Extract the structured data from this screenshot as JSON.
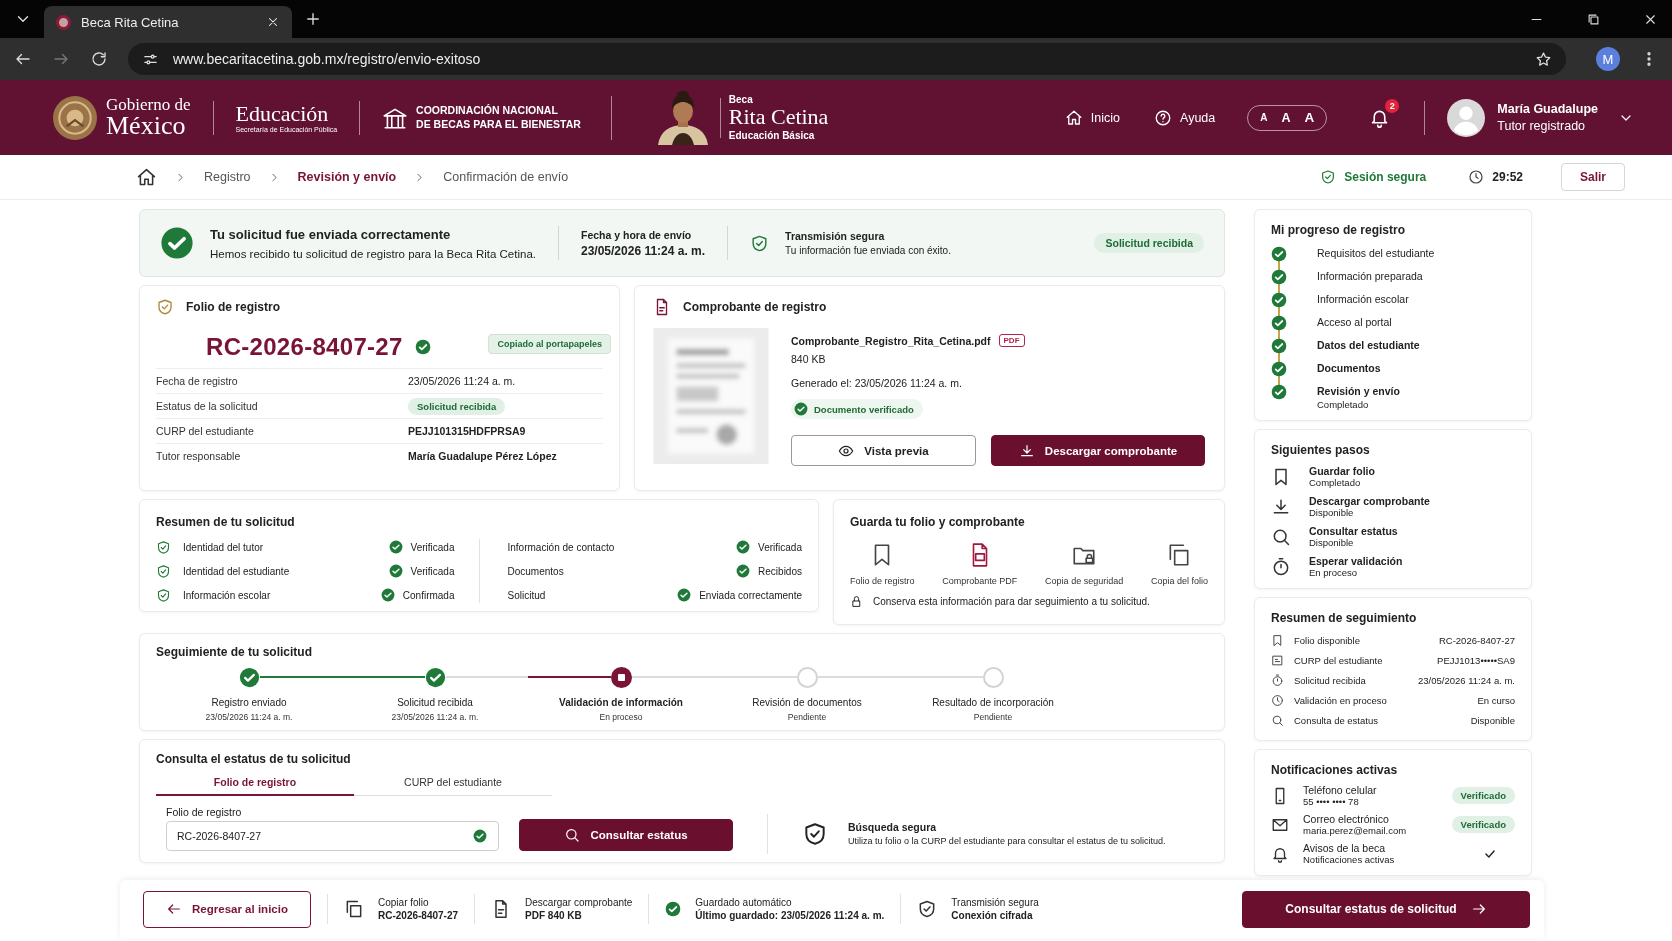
{
  "browser": {
    "tab_title": "Beca Rita Cetina",
    "url": "www.becaritacetina.gob.mx/registro/envio-exitoso",
    "profile": "M"
  },
  "header": {
    "government": [
      "Gobierno de",
      "México"
    ],
    "ministry": {
      "name": "Educación",
      "subtitle": "Secretaría de Educación Pública"
    },
    "agency": [
      "COORDINACIÓN NACIONAL",
      "DE BECAS PARA EL BIENESTAR"
    ],
    "program": {
      "kicker": "Beca",
      "name": "Rita Cetina",
      "level": "Educación Básica"
    },
    "nav": [
      {
        "label": "Inicio"
      },
      {
        "label": "Ayuda"
      }
    ],
    "text_sizes": [
      "A",
      "A",
      "A"
    ],
    "notification_count": "2",
    "user": {
      "name": "María Guadalupe",
      "role": "Tutor registrado"
    }
  },
  "breadcrumb": [
    {
      "label": "Registro",
      "selected": false
    },
    {
      "label": "Revisión y envío",
      "selected": true
    },
    {
      "label": "Confirmación de envío",
      "selected": false
    }
  ],
  "session": {
    "label": "Sesión segura",
    "timer": "29:52",
    "logout": "Salir"
  },
  "banner": {
    "title": "Tu solicitud fue enviada correctamente",
    "message": "Hemos recibido tu solicitud de registro para la Beca Rita Cetina.",
    "date_label": "Fecha y hora de envío",
    "date": "23/05/2026 11:24 a. m.",
    "security_title": "Transmisión segura",
    "security_text": "Tu información fue enviada con éxito.",
    "badge": "Solicitud recibida"
  },
  "folio": {
    "title": "Folio de registro",
    "number": "RC-2026-8407-27",
    "copied": "Copiado al portapapeles",
    "rows": [
      {
        "label": "Fecha de registro",
        "value": "23/05/2026 11:24 a. m.",
        "kind": "text"
      },
      {
        "label": "Estatus de la solicitud",
        "value": "Solicitud recibida",
        "kind": "badge"
      },
      {
        "label": "CURP del estudiante",
        "value": "PEJJ101315HDFPRSA9",
        "kind": "bold"
      },
      {
        "label": "Tutor responsable",
        "value": "María Guadalupe Pérez López",
        "kind": "bold"
      }
    ]
  },
  "receipt": {
    "title": "Comprobante de registro",
    "file_name": "Comprobante_Registro_Rita_Cetina.pdf",
    "file_type": "PDF",
    "size": "840 KB",
    "generated": "Generado el: 23/05/2026 11:24 a. m.",
    "verified": "Documento verificado",
    "buttons": [
      {
        "label": "Vista previa",
        "kind": "secondary"
      },
      {
        "label": "Descargar comprobante",
        "kind": "primary"
      }
    ]
  },
  "summary": {
    "title": "Resumen de tu solicitud",
    "left": [
      {
        "label": "Identidad del tutor",
        "status": "Verificada"
      },
      {
        "label": "Identidad del estudiante",
        "status": "Verificada"
      },
      {
        "label": "Información escolar",
        "status": "Confirmada"
      }
    ],
    "right": [
      {
        "label": "Información de contacto",
        "status": "Verificada"
      },
      {
        "label": "Documentos",
        "status": "Recibidos"
      },
      {
        "label": "Solicitud",
        "status": "Enviada correctamente"
      }
    ]
  },
  "save": {
    "title": "Guarda tu folio y comprobante",
    "items": [
      {
        "label": "Folio de registro"
      },
      {
        "label": "Comprobante PDF"
      },
      {
        "label": "Copia de seguridad"
      },
      {
        "label": "Copia del folio"
      }
    ],
    "note": "Conserva esta información para dar seguimiento a tu solicitud."
  },
  "tracking": {
    "title": "Seguimiente de tu solicitud",
    "steps": [
      {
        "label": "Registro enviado",
        "detail": "23/05/2026 11:24 a. m.",
        "kind": "done"
      },
      {
        "label": "Solicitud recibida",
        "detail": "23/05/2026 11:24 a. m.",
        "kind": "done"
      },
      {
        "label": "Validación de información",
        "detail": "En proceso",
        "kind": "current"
      },
      {
        "label": "Revisión de documentos",
        "detail": "Pendiente",
        "kind": "pending"
      },
      {
        "label": "Resultado de incorporación",
        "detail": "Pendiente",
        "kind": "pending"
      }
    ]
  },
  "query": {
    "title": "Consulta el estatus de tu solicitud",
    "tabs": [
      {
        "label": "Folio de registro",
        "selected": true
      },
      {
        "label": "CURP del estudiante",
        "selected": false
      }
    ],
    "field_label": "Folio de registro",
    "field_value": "RC-2026-8407-27",
    "valid": true,
    "button": "Consultar estatus",
    "secure_title": "Búsqueda segura",
    "secure_text": "Utiliza tu folio o la CURP del estudiante para consultar el estatus de tu solicitud."
  },
  "progress": {
    "title": "Mi progreso de registro",
    "steps": [
      {
        "label": "Requisitos del estudiante",
        "highlighted": false
      },
      {
        "label": "Información preparada",
        "highlighted": false
      },
      {
        "label": "Información escolar",
        "highlighted": false
      },
      {
        "label": "Acceso al portal",
        "highlighted": false
      },
      {
        "label": "Datos del estudiante",
        "highlighted": true
      },
      {
        "label": "Documentos",
        "highlighted": true
      },
      {
        "label": "Revisión y envío",
        "detail": "Completado",
        "highlighted": true
      }
    ]
  },
  "next_steps": {
    "title": "Siguientes pasos",
    "items": [
      {
        "label": "Guardar folio",
        "status": "Completado"
      },
      {
        "label": "Descargar comprobante",
        "status": "Disponible"
      },
      {
        "label": "Consultar estatus",
        "status": "Disponible"
      },
      {
        "label": "Esperar validación",
        "status": "En proceso"
      }
    ]
  },
  "tracking_summary": {
    "title": "Resumen de seguimiento",
    "rows": [
      {
        "label": "Folio disponible",
        "value": "RC-2026-8407-27"
      },
      {
        "label": "CURP del estudiante",
        "value": "PEJJ1013•••••SA9"
      },
      {
        "label": "Solicitud recibida",
        "value": "23/05/2026 11:24 a. m."
      },
      {
        "label": "Validación en proceso",
        "value": "En curso"
      },
      {
        "label": "Consulta de estatus",
        "value": "Disponible"
      }
    ]
  },
  "notifications": {
    "title": "Notificaciones activas",
    "items": [
      {
        "label": "Teléfono celular",
        "detail": "55 •••• •••• 78",
        "kind": "badge",
        "badge": "Verificado"
      },
      {
        "label": "Correo electrónico",
        "detail": "maria.perez@email.com",
        "kind": "badge",
        "badge": "Verificado"
      },
      {
        "label": "Avisos de la beca",
        "detail": "Notificaciones activas",
        "kind": "check",
        "checked": true
      }
    ]
  },
  "footer": {
    "back": "Regresar al inicio",
    "items": [
      {
        "title": "Copiar folio",
        "value": "RC-2026-8407-27"
      },
      {
        "title": "Descargar comprobante",
        "value": "PDF 840 KB"
      },
      {
        "title": "Guardado automático",
        "value": "Último guardado: 23/05/2026 11:24 a. m."
      },
      {
        "title": "Transmisión segura",
        "value": "Conexión cifrada"
      }
    ],
    "primary": "Consultar estatus de solicitud"
  }
}
